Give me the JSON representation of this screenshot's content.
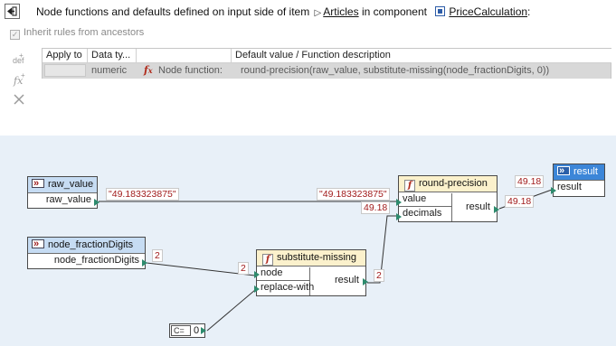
{
  "header": {
    "text": "Node functions and defaults defined on input side of item",
    "item_link": "Articles",
    "in_component": "in component",
    "component_link": "PriceCalculation",
    "colon": ":"
  },
  "inherit": {
    "label": "Inherit rules from ancestors",
    "checked": true
  },
  "table": {
    "columns": [
      "Apply to",
      "Data ty...",
      "",
      "Default value / Function description"
    ],
    "rows": [
      {
        "apply_to": "",
        "data_type": "numeric",
        "kind": "Node function:",
        "description": "round-precision(raw_value, substitute-missing(node_fractionDigits, 0))"
      }
    ]
  },
  "side_icons": [
    "add-default-icon",
    "add-function-icon",
    "delete-icon"
  ],
  "mapping": {
    "raw_value_node": {
      "title": "raw_value",
      "port": "raw_value"
    },
    "fraction_node": {
      "title": "node_fractionDigits",
      "port": "node_fractionDigits"
    },
    "substitute_node": {
      "title": "substitute-missing",
      "in1": "node",
      "in2": "replace-with",
      "out": "result"
    },
    "round_node": {
      "title": "round-precision",
      "in1": "value",
      "in2": "decimals",
      "out": "result"
    },
    "result_node": {
      "title": "result",
      "port": "result"
    },
    "constant": {
      "label": "C=",
      "value": "0"
    },
    "values": {
      "raw_out": "\"49.183323875\"",
      "raw_in": "\"49.183323875\"",
      "frac_out": "2",
      "sub_in": "2",
      "sub_out": "2",
      "decimals_in": "49.18",
      "round_out": "49.18",
      "result_in": "49.18"
    },
    "colors": {
      "pin": "#2e8b6e",
      "value_text": "#a11c1c",
      "canvas_bg": "#e8f0f8"
    }
  }
}
